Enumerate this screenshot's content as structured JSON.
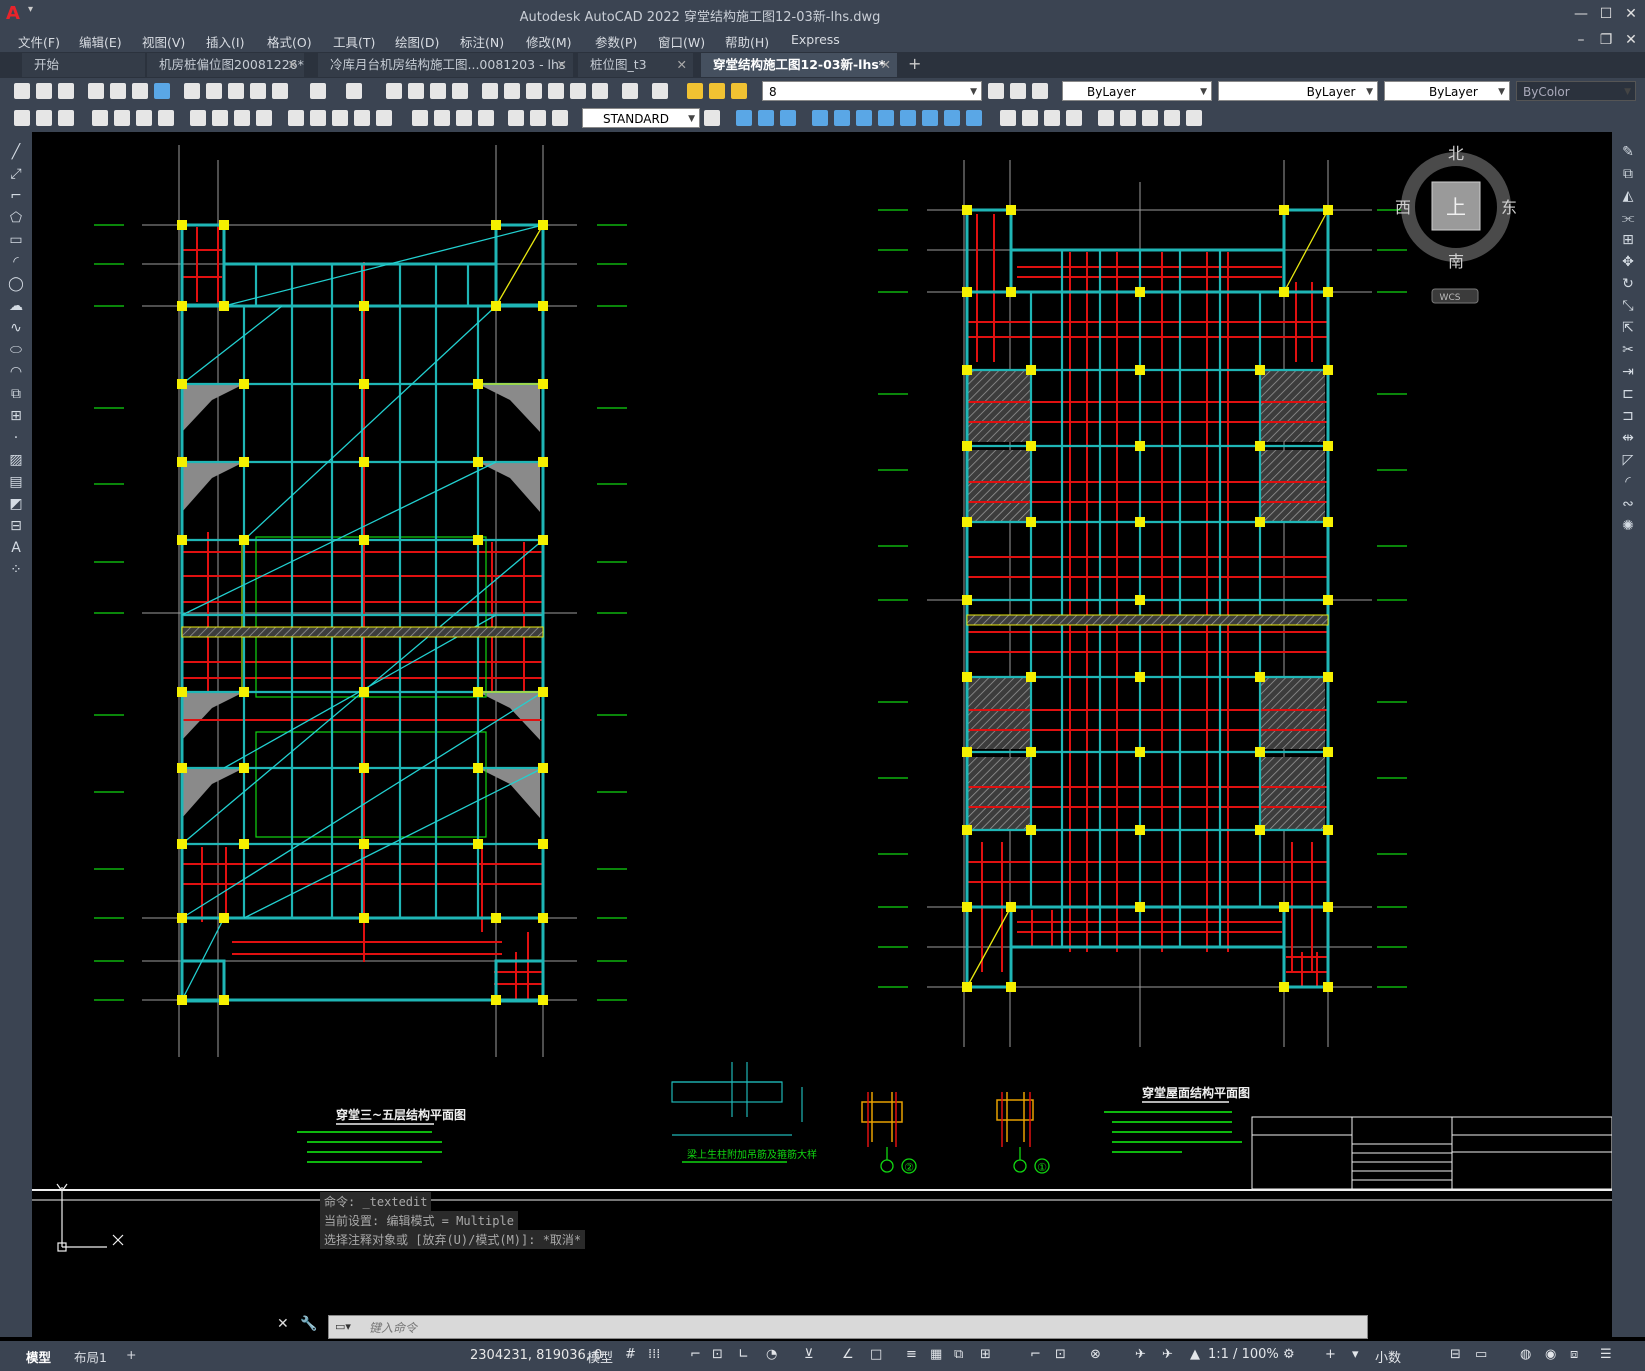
{
  "window": {
    "title": "Autodesk AutoCAD 2022    穿堂结构施工图12-03新-lhs.dwg",
    "logo": "A"
  },
  "menu": [
    "文件(F)",
    "编辑(E)",
    "视图(V)",
    "插入(I)",
    "格式(O)",
    "工具(T)",
    "绘图(D)",
    "标注(N)",
    "修改(M)",
    "参数(P)",
    "窗口(W)",
    "帮助(H)",
    "Express"
  ],
  "tabs": [
    {
      "label": "开始"
    },
    {
      "label": "机房桩偏位图20081226*"
    },
    {
      "label": "冷库月台机房结构施工图...0081203 - lhs"
    },
    {
      "label": "桩位图_t3"
    },
    {
      "label": "穿堂结构施工图12-03新-lhs*"
    }
  ],
  "toolbar": {
    "layer_value": "8",
    "color_value": "ByLayer",
    "linetype_value": "ByLayer",
    "lineweight_value": "ByLayer",
    "plotstyle_value": "ByColor",
    "textstyle_value": "STANDARD"
  },
  "viewcube": {
    "north": "北",
    "south": "南",
    "east": "东",
    "west": "西",
    "top": "上",
    "wcs": "WCS"
  },
  "drawing": {
    "left_title": "穿堂三~五层结构平面图",
    "right_title": "穿堂屋面结构平面图",
    "detail_title": "梁上生柱附加吊筋及箍筋大样",
    "detail_num_2": "②",
    "detail_num_1": "①"
  },
  "command": {
    "history": [
      "命令: _textedit",
      "当前设置: 编辑模式 = Multiple",
      "选择注释对象或 [放弃(U)/模式(M)]: *取消*"
    ],
    "placeholder": "键入命令"
  },
  "status": {
    "tabs": [
      "模型",
      "布局1"
    ],
    "coords": "2304231, 819036, 0",
    "space": "模型",
    "scale": "1:1 / 100%",
    "units": "小数"
  }
}
